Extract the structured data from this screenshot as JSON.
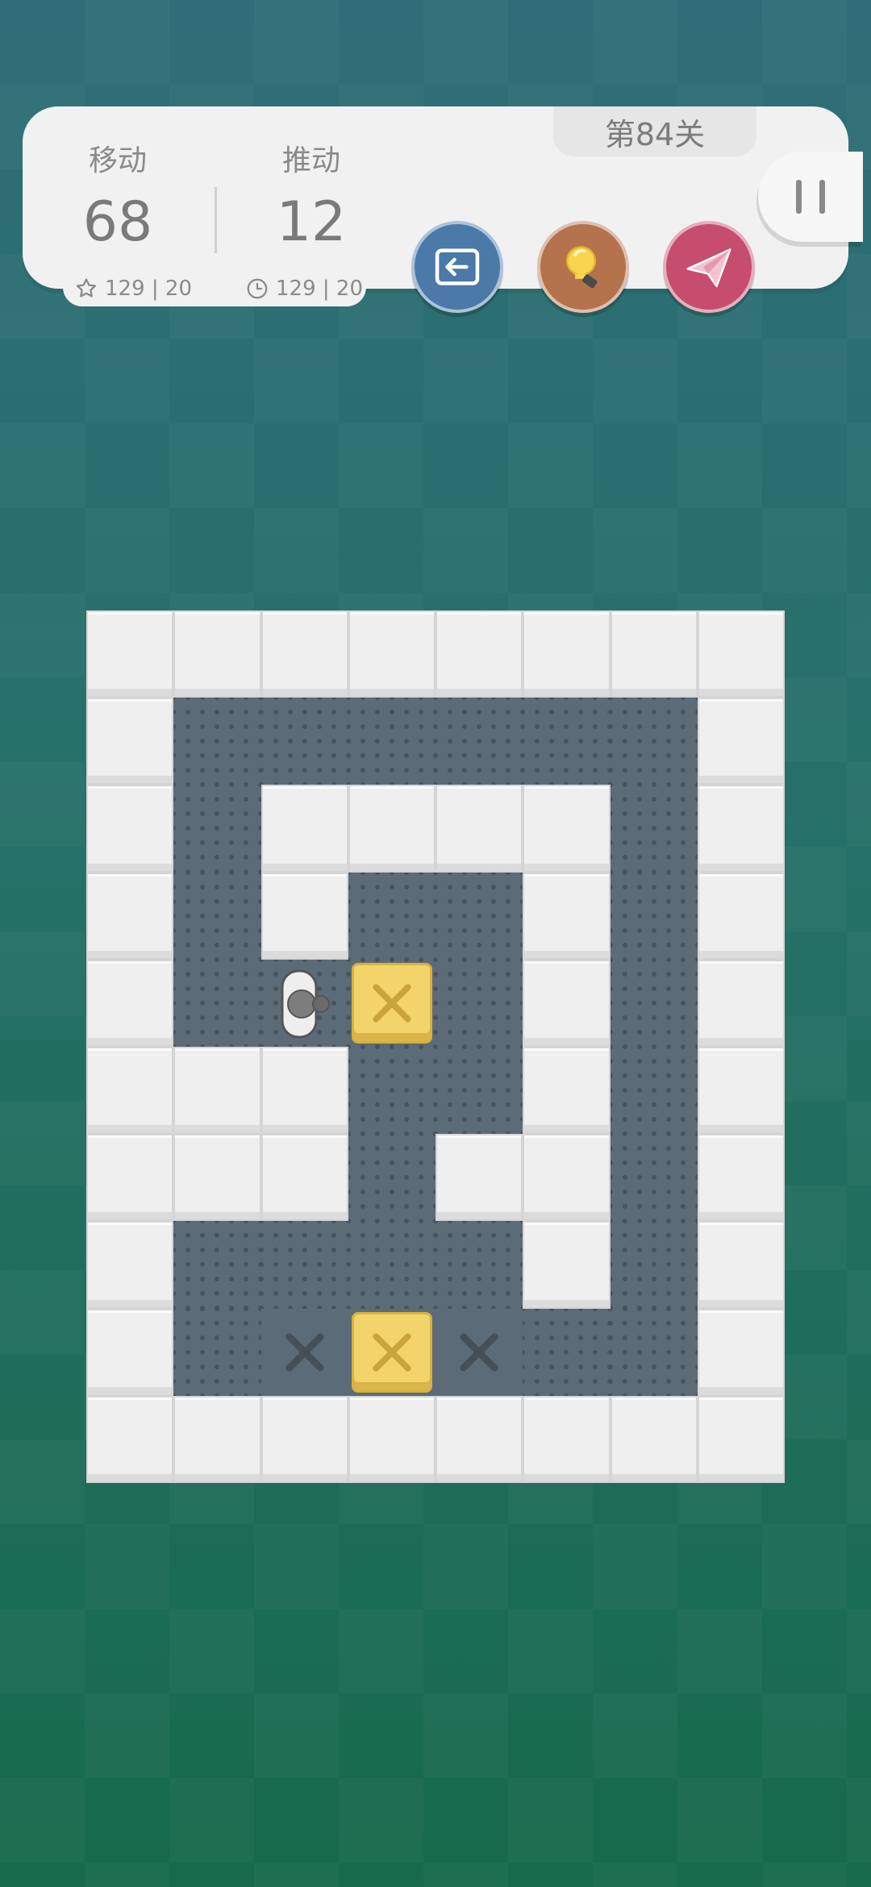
{
  "header": {
    "level_label": "第84关",
    "moves_label": "移动",
    "moves_value": "68",
    "pushes_label": "推动",
    "pushes_value": "12",
    "moves_best": "129 | 20",
    "pushes_best": "129 | 20"
  },
  "buttons": {
    "undo": "undo-icon",
    "hint": "lightbulb-icon",
    "share": "paper-plane-icon",
    "pause": "pause-icon"
  },
  "colors": {
    "undo": "#4b79a8",
    "hint": "#b5734d",
    "share": "#c64d6e",
    "box": "#f2d46a",
    "floor": "#5b6b78",
    "wall": "#efefef"
  },
  "board": {
    "cols": 8,
    "rows": 10,
    "legend": {
      "W": "wall",
      "F": "floor",
      "T": "target",
      "B": "box-on-floor",
      "P": "player",
      "X": "box-on-target"
    },
    "layout": [
      "WWWWWWWW",
      "WFFFFFFW",
      "WFWWWWFW",
      "WFWFFWFW",
      "WFPBFWFW",
      "WWWFFWFW",
      "WWWFWWFW",
      "WFFFFWFW",
      "WFTXTFFW",
      "WWWWWWWW"
    ]
  }
}
